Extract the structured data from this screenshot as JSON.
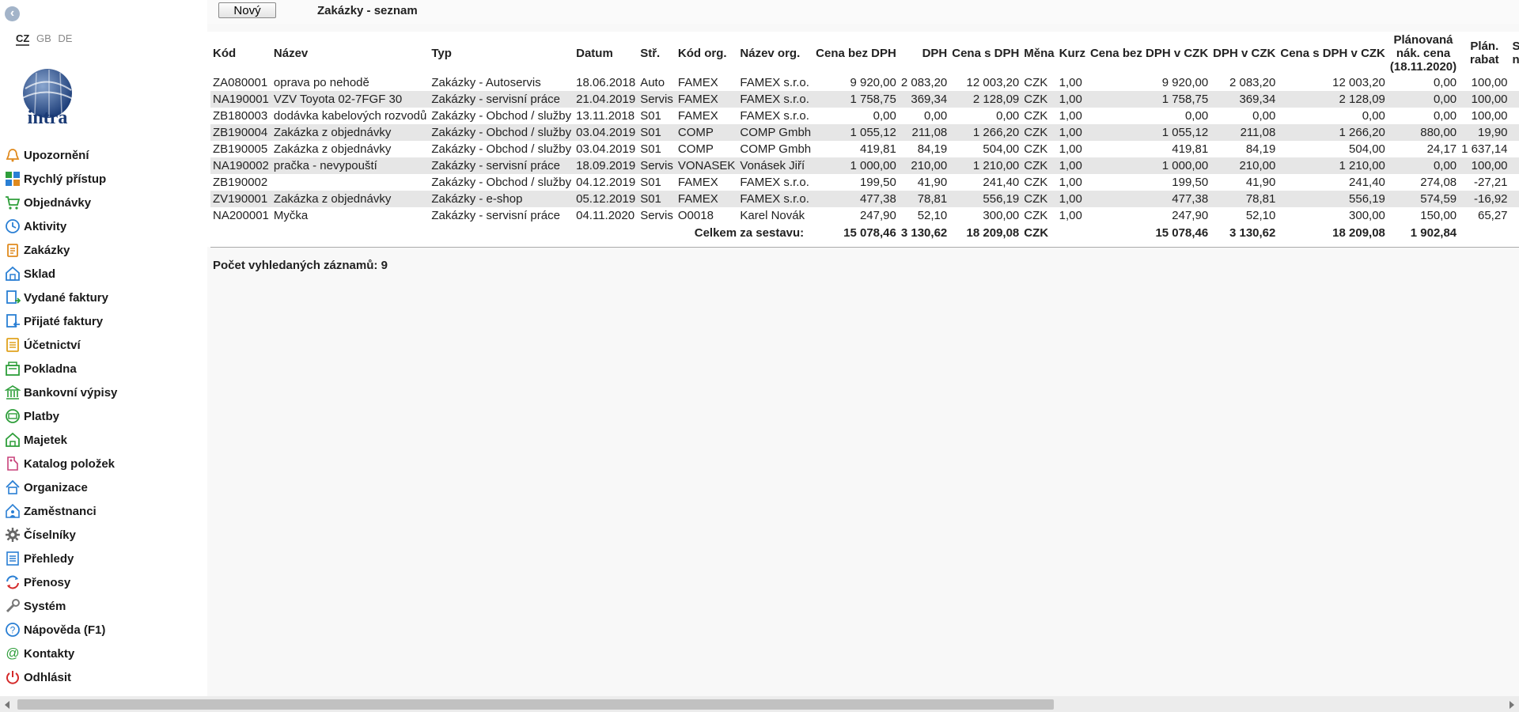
{
  "sidebar": {
    "languages": [
      "CZ",
      "GB",
      "DE"
    ],
    "logo_text": "intra",
    "items": [
      {
        "label": "Upozornění",
        "icon": "bell-icon",
        "color": "#e08a1e"
      },
      {
        "label": "Rychlý přístup",
        "icon": "tiles-icon",
        "color": "#2a7fd4"
      },
      {
        "label": "Objednávky",
        "icon": "cart-icon",
        "color": "#2e9e3a"
      },
      {
        "label": "Aktivity",
        "icon": "clock-icon",
        "color": "#2a7fd4"
      },
      {
        "label": "Zakázky",
        "icon": "clipboard-icon",
        "color": "#e08a1e"
      },
      {
        "label": "Sklad",
        "icon": "warehouse-icon",
        "color": "#2a7fd4"
      },
      {
        "label": "Vydané faktury",
        "icon": "invoice-out-icon",
        "color": "#2a7fd4"
      },
      {
        "label": "Přijaté faktury",
        "icon": "invoice-in-icon",
        "color": "#2a7fd4"
      },
      {
        "label": "Účetnictví",
        "icon": "ledger-icon",
        "color": "#e0a21e"
      },
      {
        "label": "Pokladna",
        "icon": "cashbox-icon",
        "color": "#2e9e3a"
      },
      {
        "label": "Bankovní výpisy",
        "icon": "bank-icon",
        "color": "#2e9e3a"
      },
      {
        "label": "Platby",
        "icon": "payment-icon",
        "color": "#2e9e3a"
      },
      {
        "label": "Majetek",
        "icon": "property-icon",
        "color": "#2e9e3a"
      },
      {
        "label": "Katalog položek",
        "icon": "tag-icon",
        "color": "#c8407a"
      },
      {
        "label": "Organizace",
        "icon": "building-icon",
        "color": "#2a7fd4"
      },
      {
        "label": "Zaměstnanci",
        "icon": "employee-icon",
        "color": "#2a7fd4"
      },
      {
        "label": "Číselníky",
        "icon": "gear-icon",
        "color": "#666666"
      },
      {
        "label": "Přehledy",
        "icon": "list-icon",
        "color": "#2a7fd4"
      },
      {
        "label": "Přenosy",
        "icon": "sync-icon",
        "color": "#2a7fd4"
      },
      {
        "label": "Systém",
        "icon": "wrench-icon",
        "color": "#777777"
      },
      {
        "label": "Nápověda (F1)",
        "icon": "help-icon",
        "color": "#2a7fd4"
      },
      {
        "label": "Kontakty",
        "icon": "at-icon",
        "color": "#2e9e3a"
      },
      {
        "label": "Odhlásit",
        "icon": "power-icon",
        "color": "#d42a2a"
      }
    ]
  },
  "toolbar": {
    "new_label": "Nový",
    "title": "Zakázky - seznam"
  },
  "table": {
    "columns": [
      "Kód",
      "Název",
      "Typ",
      "Datum",
      "Stř.",
      "Kód org.",
      "Název org.",
      "Cena bez DPH",
      "DPH",
      "Cena s DPH",
      "Měna",
      "Kurz",
      "Cena bez DPH v CZK",
      "DPH v CZK",
      "Cena s DPH v CZK",
      "Plánovaná nák. cena (18.11.2020)",
      "Plán. rabat",
      "Sk ná"
    ],
    "rows": [
      [
        "ZA080001",
        "oprava po nehodě",
        "Zakázky - Autoservis",
        "18.06.2018",
        "Auto",
        "FAMEX",
        "FAMEX s.r.o.",
        "9 920,00",
        "2 083,20",
        "12 003,20",
        "CZK",
        "1,00",
        "9 920,00",
        "2 083,20",
        "12 003,20",
        "0,00",
        "100,00",
        ""
      ],
      [
        "NA190001",
        "VZV Toyota 02-7FGF 30",
        "Zakázky - servisní práce",
        "21.04.2019",
        "Servis",
        "FAMEX",
        "FAMEX s.r.o.",
        "1 758,75",
        "369,34",
        "2 128,09",
        "CZK",
        "1,00",
        "1 758,75",
        "369,34",
        "2 128,09",
        "0,00",
        "100,00",
        ""
      ],
      [
        "ZB180003",
        "dodávka kabelových rozvodů",
        "Zakázky - Obchod / služby",
        "13.11.2018",
        "S01",
        "FAMEX",
        "FAMEX s.r.o.",
        "0,00",
        "0,00",
        "0,00",
        "CZK",
        "1,00",
        "0,00",
        "0,00",
        "0,00",
        "0,00",
        "100,00",
        ""
      ],
      [
        "ZB190004",
        "Zakázka z objednávky",
        "Zakázky - Obchod / služby",
        "03.04.2019",
        "S01",
        "COMP",
        "COMP Gmbh",
        "1 055,12",
        "211,08",
        "1 266,20",
        "CZK",
        "1,00",
        "1 055,12",
        "211,08",
        "1 266,20",
        "880,00",
        "19,90",
        ""
      ],
      [
        "ZB190005",
        "Zakázka z objednávky",
        "Zakázky - Obchod / služby",
        "03.04.2019",
        "S01",
        "COMP",
        "COMP Gmbh",
        "419,81",
        "84,19",
        "504,00",
        "CZK",
        "1,00",
        "419,81",
        "84,19",
        "504,00",
        "24,17",
        "1 637,14",
        ""
      ],
      [
        "NA190002",
        "pračka - nevypouští",
        "Zakázky - servisní práce",
        "18.09.2019",
        "Servis",
        "VONASEK",
        "Vonásek Jiří",
        "1 000,00",
        "210,00",
        "1 210,00",
        "CZK",
        "1,00",
        "1 000,00",
        "210,00",
        "1 210,00",
        "0,00",
        "100,00",
        ""
      ],
      [
        "ZB190002",
        "",
        "Zakázky - Obchod / služby",
        "04.12.2019",
        "S01",
        "FAMEX",
        "FAMEX s.r.o.",
        "199,50",
        "41,90",
        "241,40",
        "CZK",
        "1,00",
        "199,50",
        "41,90",
        "241,40",
        "274,08",
        "-27,21",
        ""
      ],
      [
        "ZV190001",
        "Zakázka z objednávky",
        "Zakázky - e-shop",
        "05.12.2019",
        "S01",
        "FAMEX",
        "FAMEX s.r.o.",
        "477,38",
        "78,81",
        "556,19",
        "CZK",
        "1,00",
        "477,38",
        "78,81",
        "556,19",
        "574,59",
        "-16,92",
        ""
      ],
      [
        "NA200001",
        "Myčka",
        "Zakázky - servisní práce",
        "04.11.2020",
        "Servis",
        "O0018",
        "Karel Novák",
        "247,90",
        "52,10",
        "300,00",
        "CZK",
        "1,00",
        "247,90",
        "52,10",
        "300,00",
        "150,00",
        "65,27",
        ""
      ]
    ],
    "total": {
      "label": "Celkem za sestavu:",
      "cena_bez_dph": "15 078,46",
      "dph": "3 130,62",
      "cena_s_dph": "18 209,08",
      "mena": "CZK",
      "cena_bez_dph_czk": "15 078,46",
      "dph_czk": "3 130,62",
      "cena_s_dph_czk": "18 209,08",
      "planovana": "1 902,84"
    }
  },
  "footer": {
    "count_text": "Počet vyhledaných záznamů: 9"
  }
}
